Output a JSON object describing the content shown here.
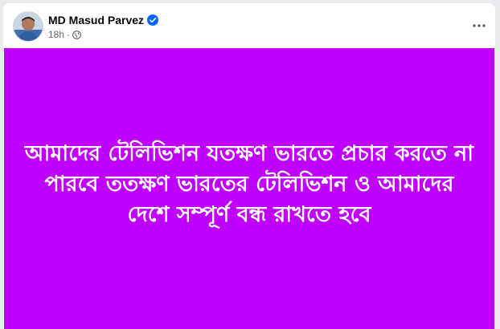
{
  "post": {
    "author_name": "MD Masud Parvez",
    "timestamp": "18h",
    "separator": "·",
    "privacy_icon": "globe-icon",
    "verified_icon": "verified-badge-icon",
    "more_icon": "more-options-icon",
    "background_color": "#bf00ff",
    "text_color": "#ffffff",
    "text": "আমাদের টেলিভিশন যতক্ষণ ভারতে প্রচার করতে না পারবে ততক্ষণ ভারতের টেলিভিশন ও আমাদের দেশে সম্পূর্ণ বন্ধ রাখতে হবে"
  },
  "colors": {
    "verified_blue": "#0866ff",
    "meta_gray": "#65676b"
  }
}
